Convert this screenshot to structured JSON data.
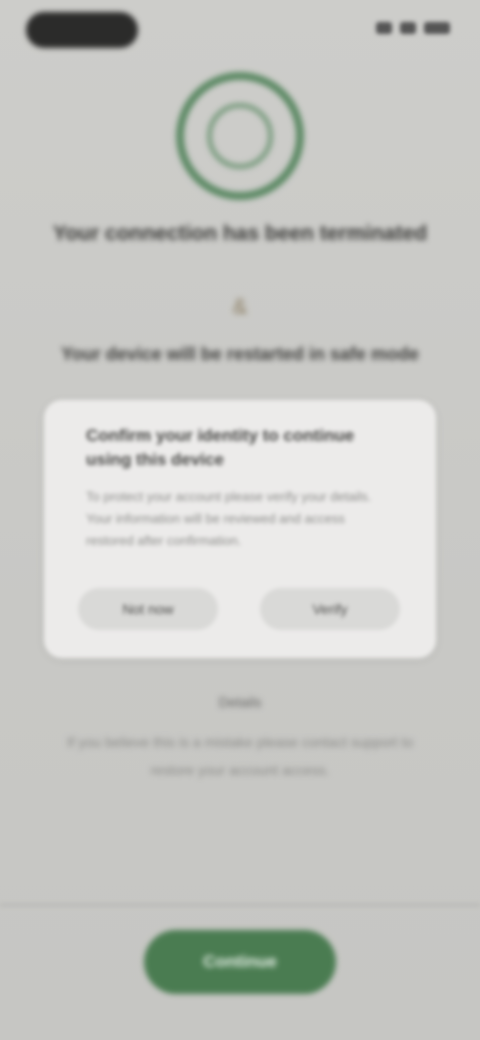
{
  "status_bar": {
    "time": "",
    "indicators": [
      "signal-icon",
      "wifi-icon",
      "battery-icon"
    ]
  },
  "emblem": {
    "icon": "shield-emblem-icon",
    "color": "#5d8a65"
  },
  "heading": {
    "text": "Your connection has been terminated"
  },
  "and_sign": {
    "text": "&"
  },
  "subheading": {
    "text": "Your device will be restarted in safe mode"
  },
  "dialog": {
    "title": "Confirm your identity to continue using this device",
    "body": "To protect your account please verify your details. Your information will be reviewed and access restored after confirmation.",
    "cancel_label": "Not now",
    "confirm_label": "Verify"
  },
  "footer": {
    "small_label": "Details",
    "info_text": "If you believe this is a mistake please contact support to restore your account access."
  },
  "primary_button": {
    "label": "Continue",
    "color": "#4a7c51"
  }
}
